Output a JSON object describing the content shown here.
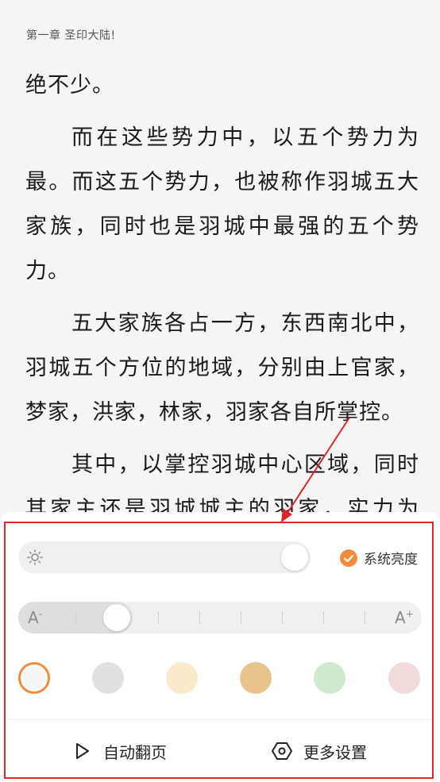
{
  "chapter": {
    "title": "第一章 圣印大陆!"
  },
  "content": {
    "paragraphs": [
      "绝不少。",
      "而在这些势力中，以五个势力为最。而这五个势力，也被称作羽城五大家族，同时也是羽城中最强的五个势力。",
      "五大家族各占一方，东西南北中，羽城五个方位的地域，分别由上官家，梦家，洪家，林家，羽家各自所掌控。",
      "其中，以掌控羽城中心区域，同时其家主还是羽城城主的羽家，实力为最！"
    ]
  },
  "settings": {
    "brightness": {
      "icon": "sun-icon",
      "level": 1.0,
      "system_label": "系统亮度",
      "system_checked": true
    },
    "font_size": {
      "decrease_label": "A",
      "decrease_mark": "-",
      "increase_label": "A",
      "increase_mark": "+",
      "level_index": 1,
      "steps": 9
    },
    "themes": [
      {
        "name": "white",
        "color": "#f5f5f5",
        "selected": true
      },
      {
        "name": "gray",
        "color": "#e0e0e0",
        "selected": false
      },
      {
        "name": "cream",
        "color": "#fbe9cb",
        "selected": false
      },
      {
        "name": "tan",
        "color": "#e9c38c",
        "selected": false
      },
      {
        "name": "green",
        "color": "#cdeacd",
        "selected": false
      },
      {
        "name": "pink",
        "color": "#f1dada",
        "selected": false
      }
    ],
    "auto_page": {
      "label": "自动翻页",
      "icon": "play-icon"
    },
    "more_settings": {
      "label": "更多设置",
      "icon": "hexagon-settings-icon"
    }
  },
  "colors": {
    "accent": "#f28c3c",
    "annotation": "#e0242b"
  }
}
